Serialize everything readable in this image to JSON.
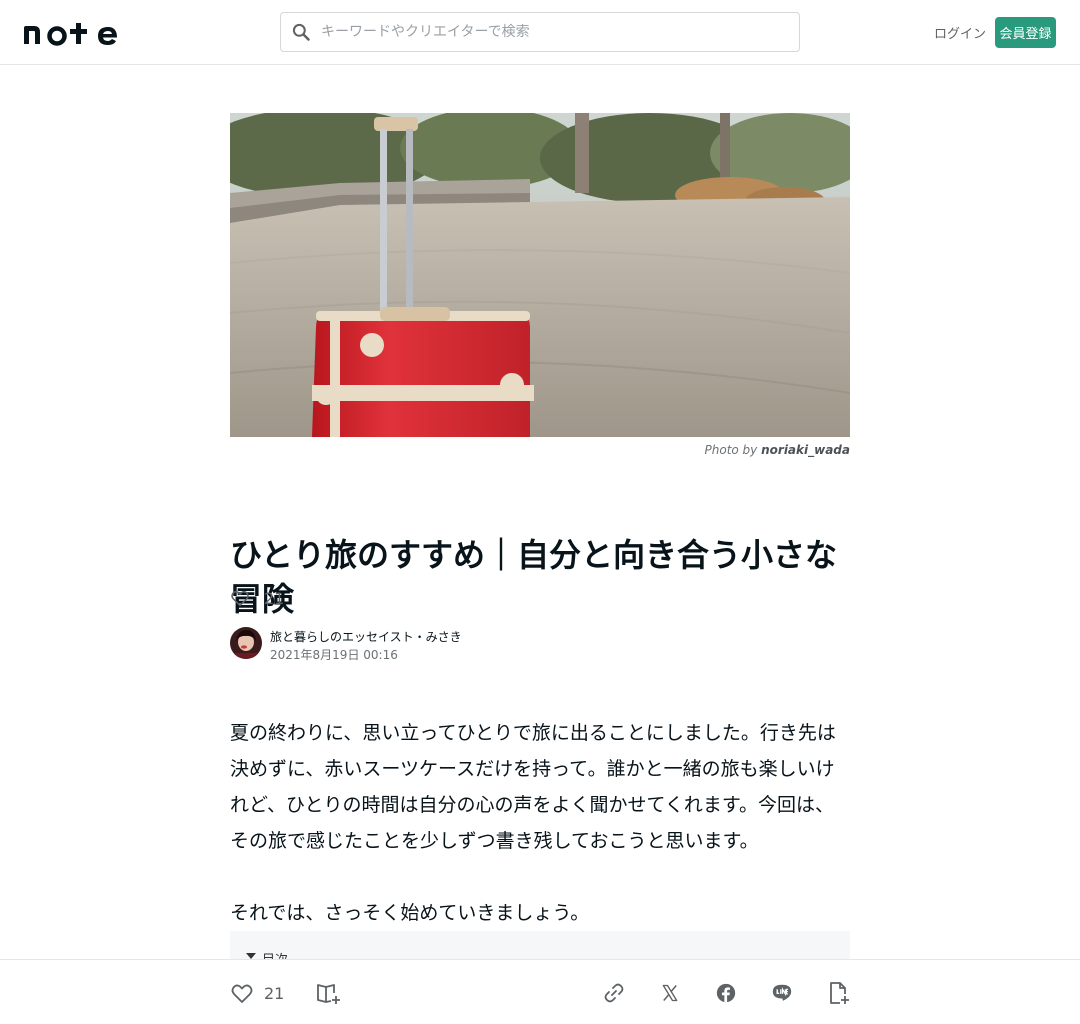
{
  "header": {
    "logo_text": "note",
    "search_placeholder": "キーワードやクリエイターで検索",
    "login_label": "ログイン",
    "signup_label": "会員登録"
  },
  "article": {
    "photo_credit_prefix": "Photo by",
    "photo_credit_author": "noriaki_wada",
    "title": "ひとり旅のすすめ｜自分と向き合う小さな冒険",
    "like_count": "21",
    "author_name": "旅と暮らしのエッセイスト・みさき",
    "date": "2021年8月19日 00:16",
    "paragraphs": [
      "夏の終わりに、思い立ってひとりで旅に出ることにしました。行き先は決めずに、赤いスーツケースだけを持って。誰かと一緒の旅も楽しいけれど、ひとりの時間は自分の心の声をよく聞かせてくれます。今回は、その旅で感じたことを少しずつ書き残しておこうと思います。",
      "それでは、さっそく始めていきましょう。"
    ],
    "toc_label": "目次"
  },
  "actionbar": {
    "like_count": "21"
  },
  "icons": {
    "search": "search-icon",
    "heart": "heart-icon",
    "magazine_add": "magazine-add-icon",
    "link": "link-icon",
    "x": "x-icon",
    "facebook": "facebook-icon",
    "line": "line-icon",
    "note_add": "note-add-icon"
  },
  "colors": {
    "accent": "#2a9a7e",
    "text": "#08131a",
    "muted": "#5d6266"
  }
}
